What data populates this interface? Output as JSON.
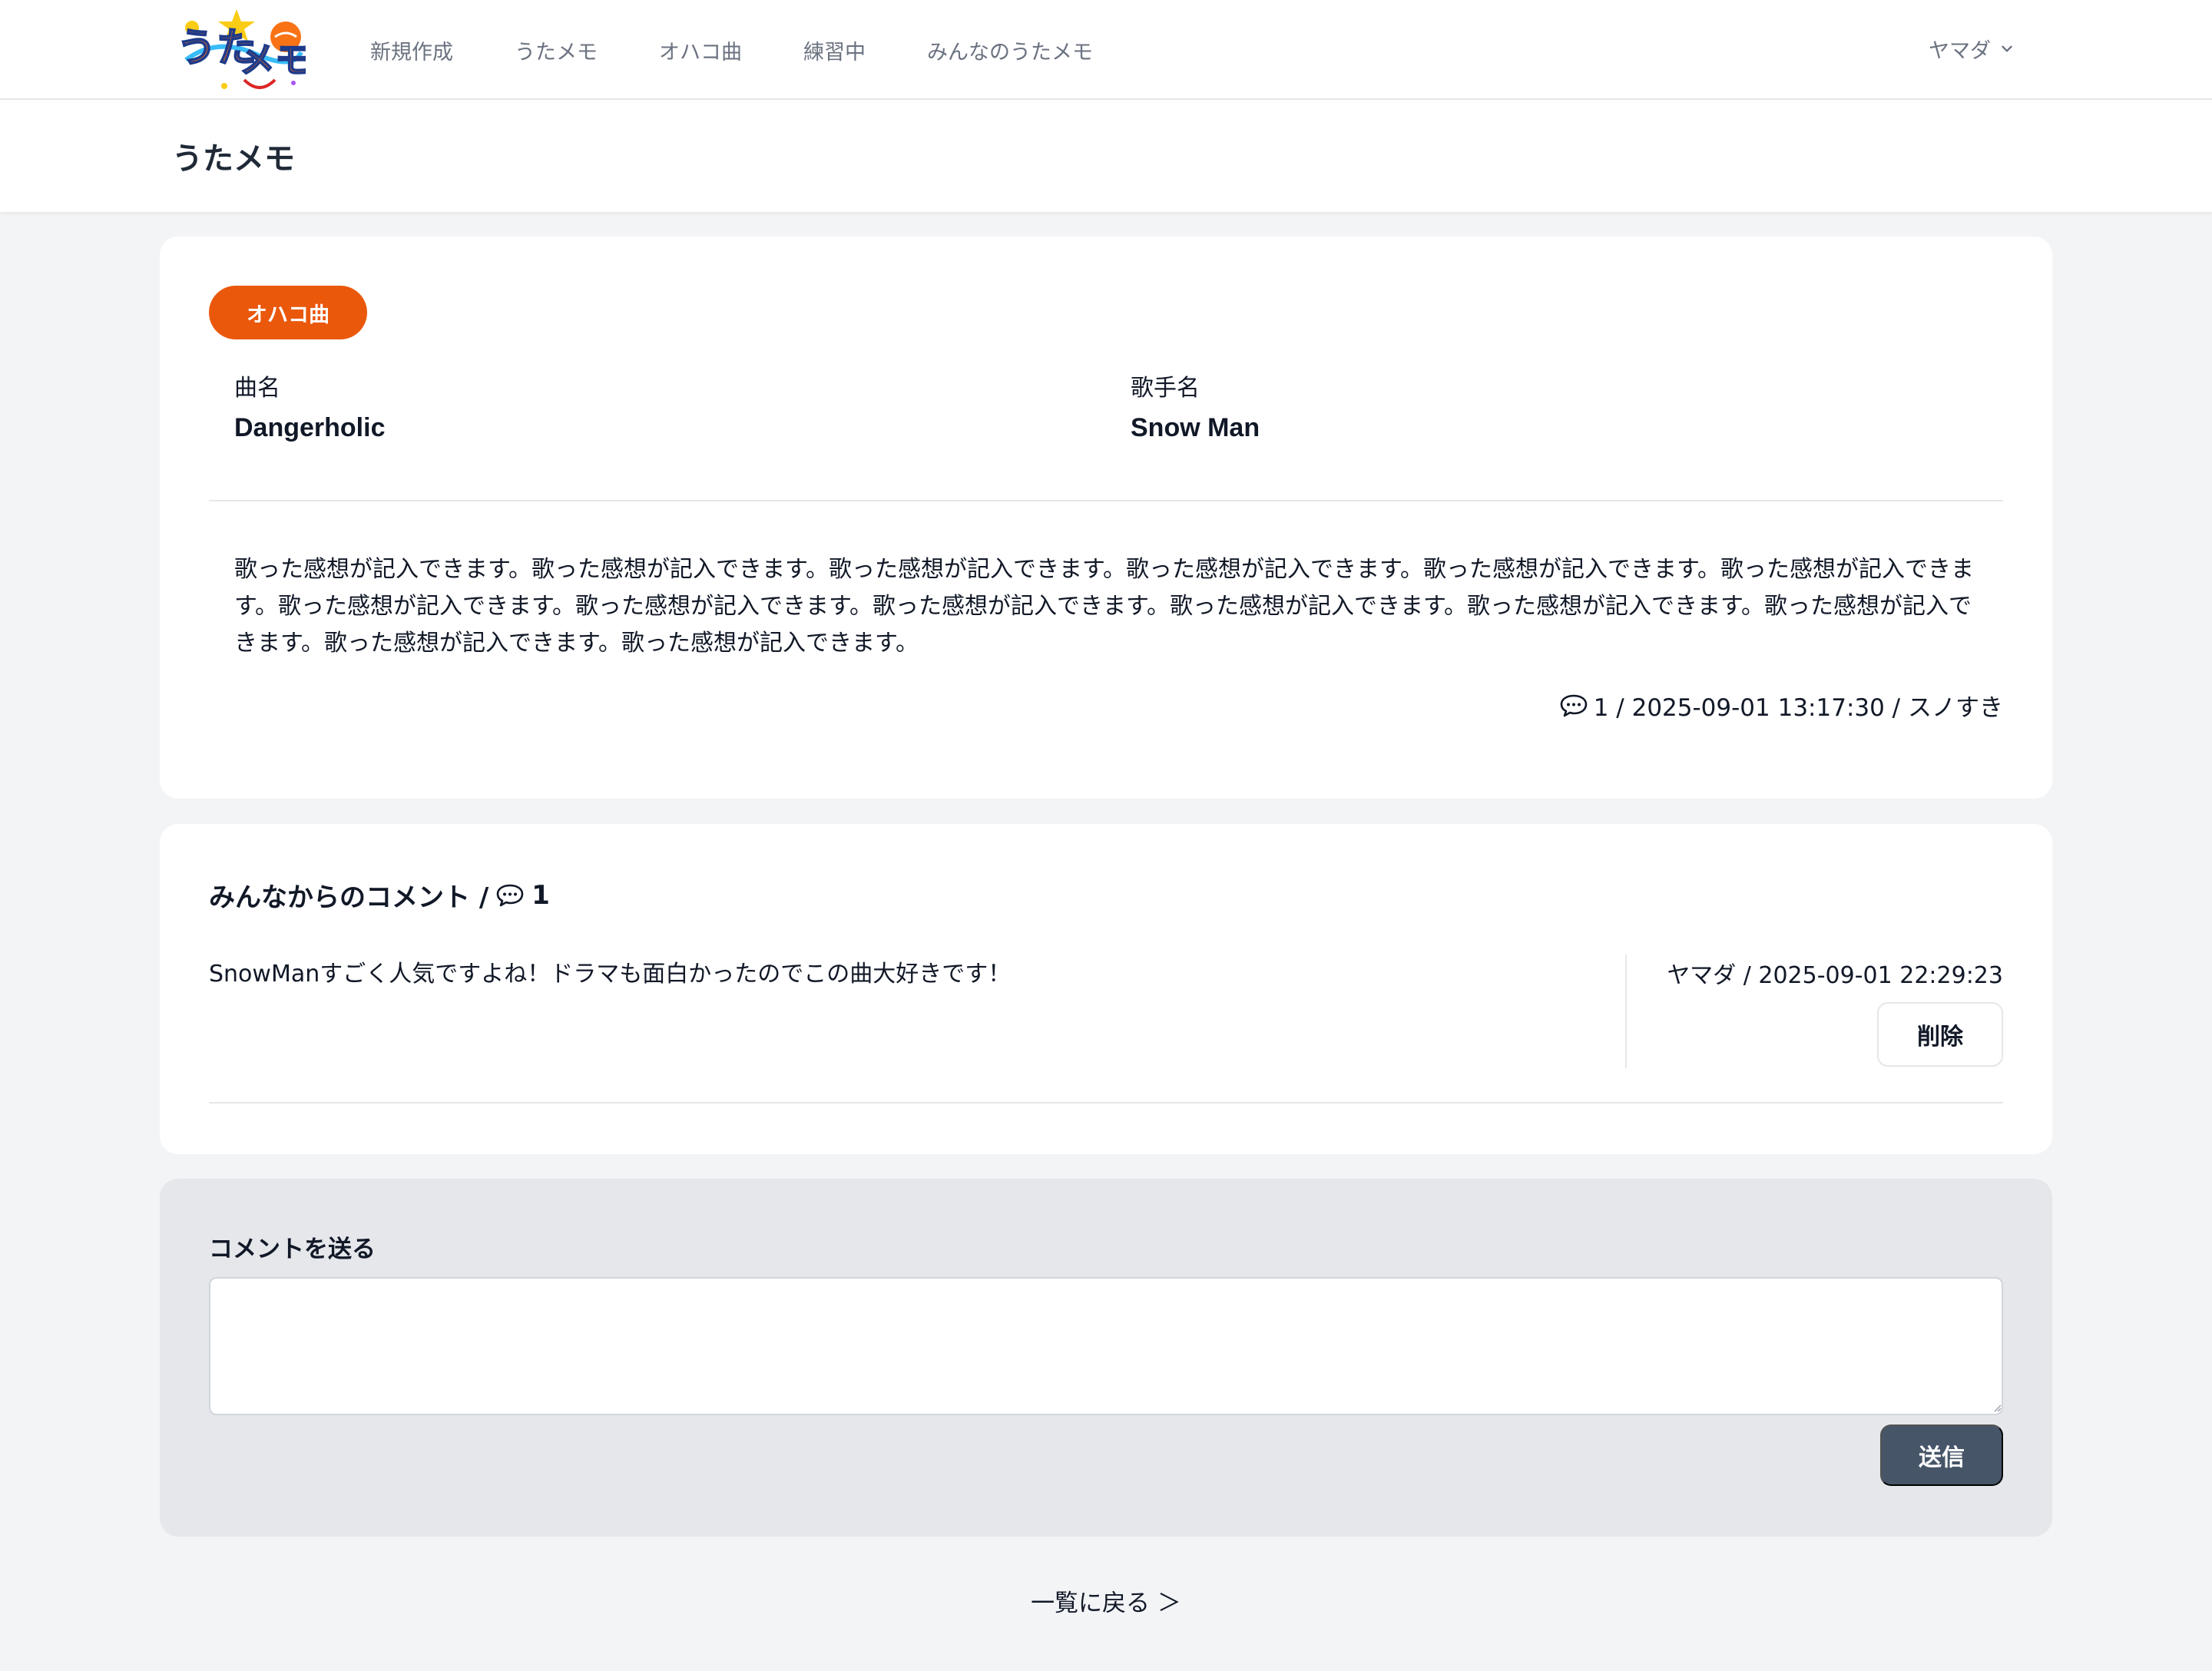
{
  "nav": {
    "logo_text": "うたメモ",
    "links": [
      "新規作成",
      "うたメモ",
      "オハコ曲",
      "練習中",
      "みんなのうたメモ"
    ],
    "user_name": "ヤマダ"
  },
  "page": {
    "title": "うたメモ"
  },
  "memo": {
    "badge": "オハコ曲",
    "song_label": "曲名",
    "song_title": "Dangerholic",
    "artist_label": "歌手名",
    "artist_name": "Snow Man",
    "body": "歌った感想が記入できます。歌った感想が記入できます。歌った感想が記入できます。歌った感想が記入できます。歌った感想が記入できます。歌った感想が記入できます。歌った感想が記入できます。歌った感想が記入できます。歌った感想が記入できます。歌った感想が記入できます。歌った感想が記入できます。歌った感想が記入できます。歌った感想が記入できます。歌った感想が記入できます。",
    "meta": "1 / 2025-09-01 13:17:30 / スノすき"
  },
  "comments": {
    "title": "みんなからのコメント /",
    "count": "1",
    "items": [
      {
        "text": "SnowManすごく人気ですよね！ドラマも面白かったのでこの曲大好きです！",
        "meta": "ヤマダ / 2025-09-01 22:29:23",
        "delete_label": "削除"
      }
    ]
  },
  "comment_form": {
    "title": "コメントを送る",
    "value": "",
    "submit_label": "送信"
  },
  "footer": {
    "back_label": "一覧に戻る ＞"
  },
  "colors": {
    "accent": "#ea580c",
    "submit": "#475569",
    "background": "#f3f4f6",
    "form_background": "#e5e7eb"
  },
  "icons": [
    "logo",
    "chevron-down-icon",
    "chat-bubble-icon",
    "resize-grip-icon"
  ]
}
